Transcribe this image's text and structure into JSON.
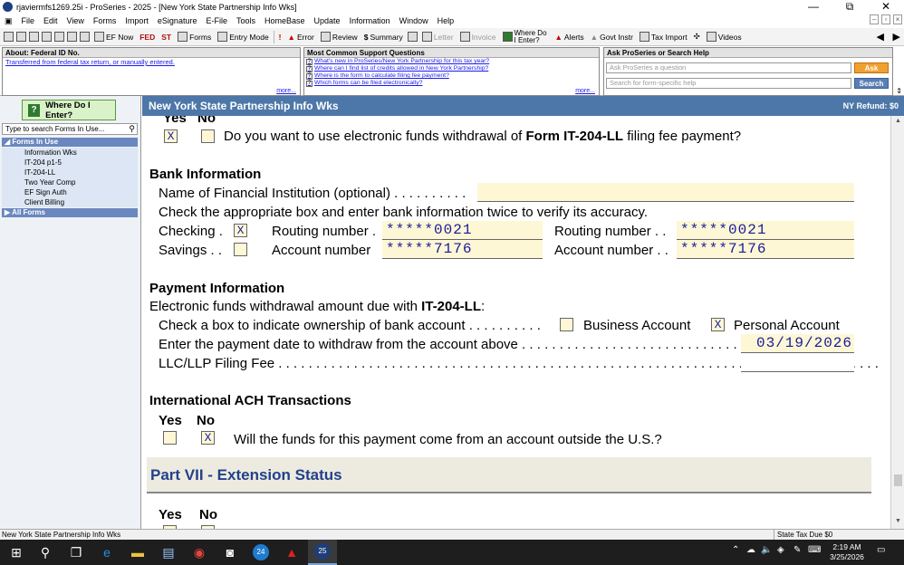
{
  "window": {
    "title": "rjaviermfs1269.25i - ProSeries - 2025 - [New York State Partnership Info Wks]",
    "minimize": "—",
    "restore": "⧉",
    "close": "✕"
  },
  "menu": [
    "File",
    "Edit",
    "View",
    "Forms",
    "Import",
    "eSignature",
    "E-File",
    "Tools",
    "HomeBase",
    "Update",
    "Information",
    "Window",
    "Help"
  ],
  "toolbar": {
    "efnow": "EF Now",
    "fed": "FED",
    "st": "ST",
    "forms": "Forms",
    "entry_mode": "Entry Mode",
    "error": "Error",
    "review": "Review",
    "summary": "Summary",
    "letter": "Letter",
    "invoice": "Invoice",
    "where_do": "Where Do I Enter?",
    "alerts": "Alerts",
    "govt_instr": "Govt Instr",
    "tax_import": "Tax Import",
    "videos": "Videos"
  },
  "panels": {
    "about": {
      "title": "About: Federal ID No.",
      "link": "Transferred from federal tax return, or manually entered.",
      "more": "more..."
    },
    "support": {
      "title": "Most Common Support Questions",
      "questions": [
        "What's new in ProSeries/New York Partnership for this tax year?",
        "Where can I find list of credits allowed in New York Partnership?",
        "Where is the form to calculate filing fee payment?",
        "Which forms can be filed electronically?"
      ],
      "more": "more..."
    },
    "ask": {
      "title": "Ask ProSeries or Search Help",
      "ask_placeholder": "Ask ProSeries a question",
      "ask_button": "Ask",
      "search_placeholder": "Search for form-specific help",
      "search_button": "Search"
    }
  },
  "sidebar": {
    "where_do_i_enter": "Where Do I Enter?",
    "search_placeholder": "Type to search Forms In Use...",
    "forms_in_use": "Forms In Use",
    "items": [
      "Information Wks",
      "IT-204 p1-5",
      "IT-204-LL",
      "Two Year Comp",
      "EF Sign Auth",
      "Client Billing"
    ],
    "all_forms": "All Forms"
  },
  "form": {
    "header": "New York State Partnership Info Wks",
    "refund": "NY Refund: $0",
    "top": {
      "yes": "Yes",
      "no": "No",
      "yes_value": "X",
      "no_value": "",
      "question_pre": "Do you want to use electronic funds withdrawal of ",
      "question_bold": "Form IT-204-LL",
      "question_post": " filing fee payment?"
    },
    "bank": {
      "title": "Bank Information",
      "institution_label": "Name of Financial Institution (optional) . . . . . . . . . .",
      "institution_value": "",
      "instructions": "Check the appropriate box and enter bank information twice to verify its accuracy.",
      "checking_label": "Checking .",
      "checking_value": "X",
      "savings_label": "Savings . .",
      "savings_value": "",
      "routing_label1": "Routing number .",
      "routing_value1": "*****0021",
      "account_label1": "Account number",
      "account_value1": "*****7176",
      "routing_label2": "Routing number . .",
      "routing_value2": "*****0021",
      "account_label2": "Account number . .",
      "account_value2": "*****7176"
    },
    "payment": {
      "title": "Payment Information",
      "line_pre": "Electronic funds withdrawal amount due with ",
      "line_bold": "IT-204-LL",
      "line_post": ":",
      "ownership_label": "Check a box to indicate ownership of bank account . . . . . . . . . .",
      "business_value": "",
      "business_label": "Business Account",
      "personal_value": "X",
      "personal_label": "Personal Account",
      "date_label": "Enter the payment date to withdraw from the account above . . . . . . . . . . . . . . . . . . . . . . . . . . . . . .",
      "date_value": "03/19/2026",
      "fee_label": "LLC/LLP Filing Fee . . . . . . . . . . . . . . . . . . . . . . . . . . . . . . . . . . . . . . . . . . . . . . . . . . . . . . . . . . . . . . . . . . . . . . . . . . . . . . . .",
      "fee_value": ""
    },
    "ach": {
      "title": "International ACH Transactions",
      "yes": "Yes",
      "no": "No",
      "yes_value": "",
      "no_value": "X",
      "question": "Will the funds for this payment come from an account outside the U.S.?"
    },
    "part7": {
      "title": "Part VII - Extension Status",
      "yes": "Yes",
      "no": "No"
    }
  },
  "status": {
    "left": "New York State Partnership Info Wks",
    "right": "State Tax Due $0"
  },
  "taskbar": {
    "clock_time": "2:19 AM",
    "clock_date": "3/25/2026",
    "badge24": "24",
    "badge25": "25"
  }
}
